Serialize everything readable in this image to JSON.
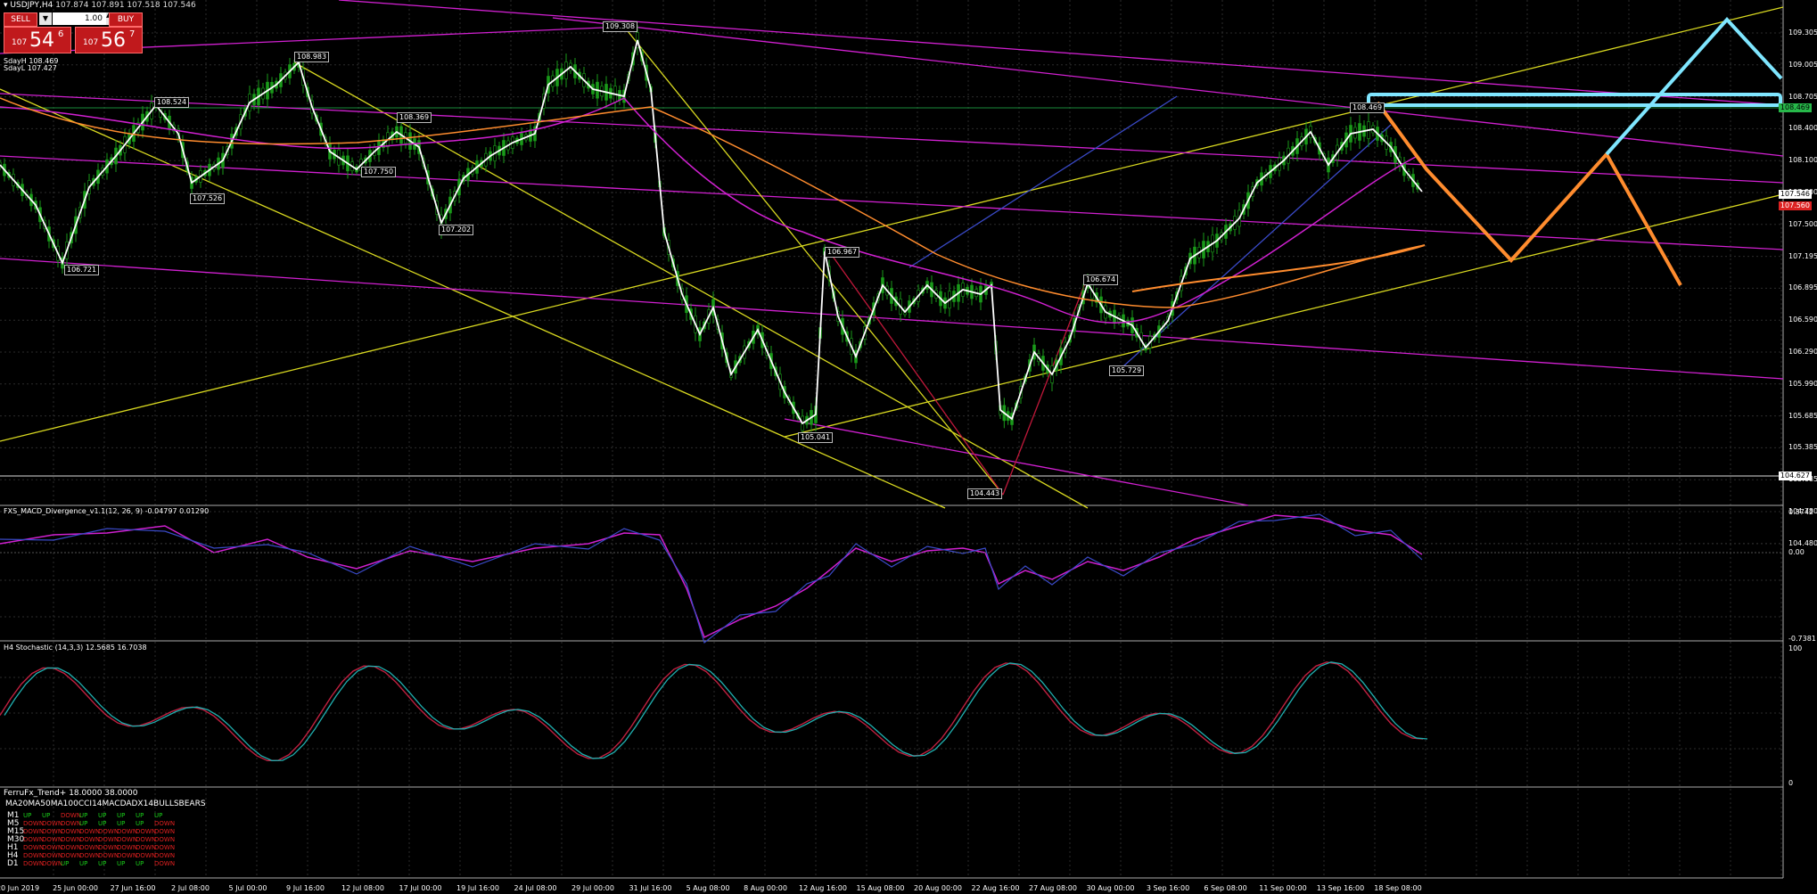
{
  "header": {
    "symbol": "USDJPY,H4",
    "ohlc": "107.874 107.891 107.518 107.546",
    "sd_high": "SdayH 108.469",
    "sd_low": "SdayL 107.427"
  },
  "trade_panel": {
    "sell_label": "SELL",
    "buy_label": "BUY",
    "lot_dropdown": "▼",
    "lot_value": "1.00",
    "lot_spin": "▲▼",
    "sell_quote": {
      "small": "107",
      "big": "54",
      "sup": "6"
    },
    "buy_quote": {
      "small": "107",
      "big": "56",
      "sup": "7"
    }
  },
  "price_axis": [
    "109.305",
    "109.005",
    "108.705",
    "108.400",
    "108.100",
    "107.800",
    "107.500",
    "107.195",
    "106.895",
    "106.590",
    "106.290",
    "105.990",
    "105.685",
    "105.385",
    "105.085",
    "104.780",
    "104.480"
  ],
  "price_tags": {
    "sd_high": "108.469",
    "bid": "107.546",
    "ask": "107.560",
    "line_low": "104.627"
  },
  "colors": {
    "accent_cyan": "#7fe6ff",
    "orange": "#ff8c2e",
    "magenta": "#d020d0",
    "yellow": "#d8d820",
    "green_candle": "#1a9a1a",
    "sell_red": "#c0191c"
  },
  "pivot_labels": [
    "106.721",
    "108.524",
    "107.526",
    "108.983",
    "107.750",
    "108.369",
    "107.202",
    "109.308",
    "106.967",
    "105.041",
    "106.674",
    "105.729",
    "104.443",
    "108.469"
  ],
  "macd": {
    "title": "FXS_MACD_Divergence_v1.1(12, 26, 9) -0.04797 0.01290",
    "axis": [
      "0.3742",
      "0.00",
      "-0.7381"
    ]
  },
  "stoch": {
    "title": "H4 Stochastic (14,3,3) 12.5685 16.7038",
    "axis": [
      "100",
      "0"
    ]
  },
  "trend": {
    "title": "FerruFx_Trend+ 18.0000 38.0000",
    "headers": "MA20MA50MA100CCI14MACDADX14BULLSBEARS",
    "rows": [
      {
        "tf": "M1",
        "states": [
          "UP",
          "UP",
          "DOWN",
          "UP",
          "UP",
          "UP",
          "UP",
          "UP"
        ]
      },
      {
        "tf": "M5",
        "states": [
          "DOWN",
          "DOWN",
          "DOWN",
          "UP",
          "UP",
          "UP",
          "UP",
          "DOWN"
        ]
      },
      {
        "tf": "M15",
        "states": [
          "DOWN",
          "DOWN",
          "DOWN",
          "DOWN",
          "DOWN",
          "DOWN",
          "DOWN",
          "DOWN"
        ]
      },
      {
        "tf": "M30",
        "states": [
          "DOWN",
          "DOWN",
          "DOWN",
          "DOWN",
          "DOWN",
          "DOWN",
          "DOWN",
          "DOWN"
        ]
      },
      {
        "tf": "H1",
        "states": [
          "DOWN",
          "DOWN",
          "DOWN",
          "DOWN",
          "DOWN",
          "DOWN",
          "DOWN",
          "DOWN"
        ]
      },
      {
        "tf": "H4",
        "states": [
          "DOWN",
          "DOWN",
          "DOWN",
          "DOWN",
          "DOWN",
          "DOWN",
          "DOWN",
          "DOWN"
        ]
      },
      {
        "tf": "D1",
        "states": [
          "DOWN",
          "DOWN",
          "UP",
          "UP",
          "UP",
          "UP",
          "UP",
          "DOWN"
        ]
      }
    ]
  },
  "time_axis": [
    "20 Jun 2019",
    "25 Jun 00:00",
    "27 Jun 16:00",
    "2 Jul 08:00",
    "5 Jul 00:00",
    "9 Jul 16:00",
    "12 Jul 08:00",
    "17 Jul 00:00",
    "19 Jul 16:00",
    "24 Jul 08:00",
    "29 Jul 00:00",
    "31 Jul 16:00",
    "5 Aug 08:00",
    "8 Aug 00:00",
    "12 Aug 16:00",
    "15 Aug 08:00",
    "20 Aug 00:00",
    "22 Aug 16:00",
    "27 Aug 08:00",
    "30 Aug 00:00",
    "3 Sep 16:00",
    "6 Sep 08:00",
    "11 Sep 00:00",
    "13 Sep 16:00",
    "18 Sep 08:00"
  ]
}
